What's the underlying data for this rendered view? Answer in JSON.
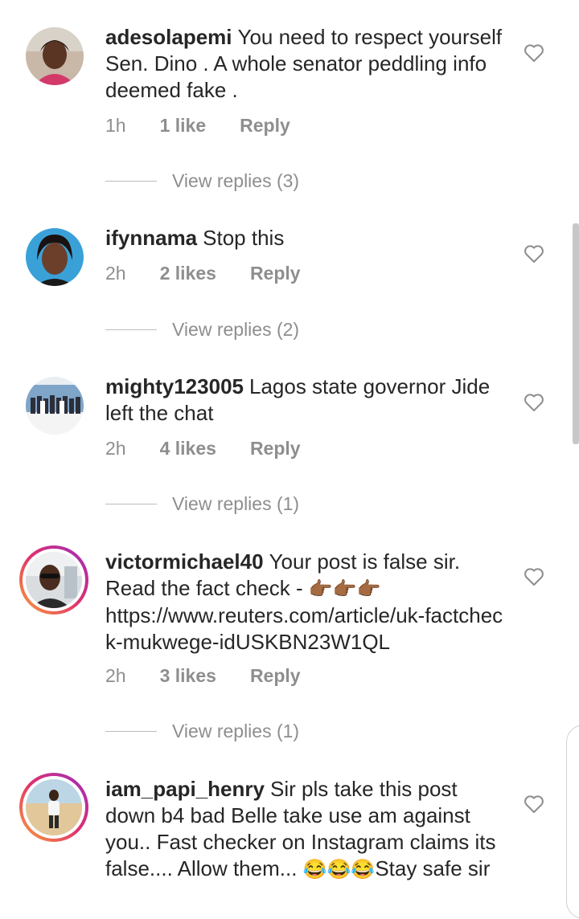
{
  "comments": [
    {
      "username": "adesolapemi",
      "text": "You need to respect yourself Sen. Dino . A whole senator peddling info deemed fake .",
      "time": "1h",
      "likes": "1 like",
      "reply": "Reply",
      "view_replies": "View replies (3)",
      "avatar_icon": "profile-photo-woman"
    },
    {
      "username": "ifynnama",
      "text": "Stop this",
      "time": "2h",
      "likes": "2 likes",
      "reply": "Reply",
      "view_replies": "View replies (2)",
      "avatar_icon": "profile-photo-woman-blue"
    },
    {
      "username": "mighty123005",
      "text": "Lagos state governor Jide left the chat",
      "time": "2h",
      "likes": "4 likes",
      "reply": "Reply",
      "view_replies": "View replies (1)",
      "avatar_icon": "profile-photo-group"
    },
    {
      "username": "victormichael40",
      "text_before_emoji": "Your post is false sir. Read the fact check - ",
      "emoji": "👉🏾👉🏾👉🏾",
      "link": "https://www.reuters.com/article/uk-factcheck-mukwege-idUSKBN23W1QL",
      "time": "2h",
      "likes": "3 likes",
      "reply": "Reply",
      "view_replies": "View replies (1)",
      "avatar_icon": "profile-photo-man-story-ring"
    },
    {
      "username": "iam_papi_henry",
      "text_before_emoji": "Sir pls take this post down b4 bad Belle take use am against you.. Fast checker on Instagram claims its false.... Allow them... ",
      "emoji": "😂😂😂",
      "text_after_emoji": "Stay safe sir",
      "avatar_icon": "profile-photo-man-beach-story-ring"
    }
  ],
  "colors": {
    "primary_text": "#262626",
    "secondary_text": "#8e8e8e",
    "story_ring_start": "#f9a43a",
    "story_ring_end": "#9b2cc1"
  },
  "icons": {
    "like": "heart-outline-icon"
  }
}
